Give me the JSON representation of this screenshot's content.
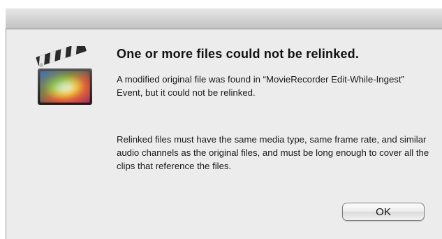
{
  "dialog": {
    "heading": "One or more files could not be relinked.",
    "message": "A modified original file was found in “MovieRecorder Edit-While-Ingest” Event, but it could not be relinked.",
    "detail": "Relinked files must have the same media type, same frame rate, and similar audio channels as the original files, and must be long enough to cover all the clips that reference the files.",
    "ok_label": "OK",
    "icon": "final-cut-pro-clapperboard-icon"
  },
  "colors": {
    "titlebar": "#d3d3d3",
    "dialog_background": "#ececec",
    "text": "#111111"
  }
}
